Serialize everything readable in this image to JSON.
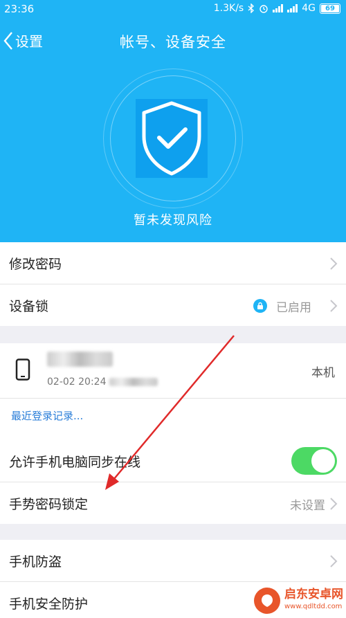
{
  "status_bar": {
    "time": "23:36",
    "speed": "1.3K/s",
    "network": "4G",
    "battery": "69"
  },
  "nav": {
    "back_label": "设置",
    "title": "帐号、设备安全"
  },
  "security": {
    "status_text": "暂未发现风险"
  },
  "menu": {
    "change_password": "修改密码",
    "device_lock": "设备锁",
    "device_lock_status": "已启用",
    "sync_online": "允许手机电脑同步在线",
    "gesture_lock": "手势密码锁定",
    "gesture_lock_status": "未设置",
    "anti_theft": "手机防盗",
    "security_protection": "手机安全防护"
  },
  "device": {
    "time_prefix": "02-02 20:24",
    "current_label": "本机"
  },
  "recent_login": "最近登录记录...",
  "toggle": {
    "sync_online_on": true
  },
  "watermark": {
    "name": "启东安卓网",
    "url": "www.qdltdd.com"
  },
  "colors": {
    "header_blue": "#1fb4f5",
    "toggle_green": "#4cd964",
    "link_blue": "#2a7ed8",
    "arrow_red": "#e02a2a"
  }
}
